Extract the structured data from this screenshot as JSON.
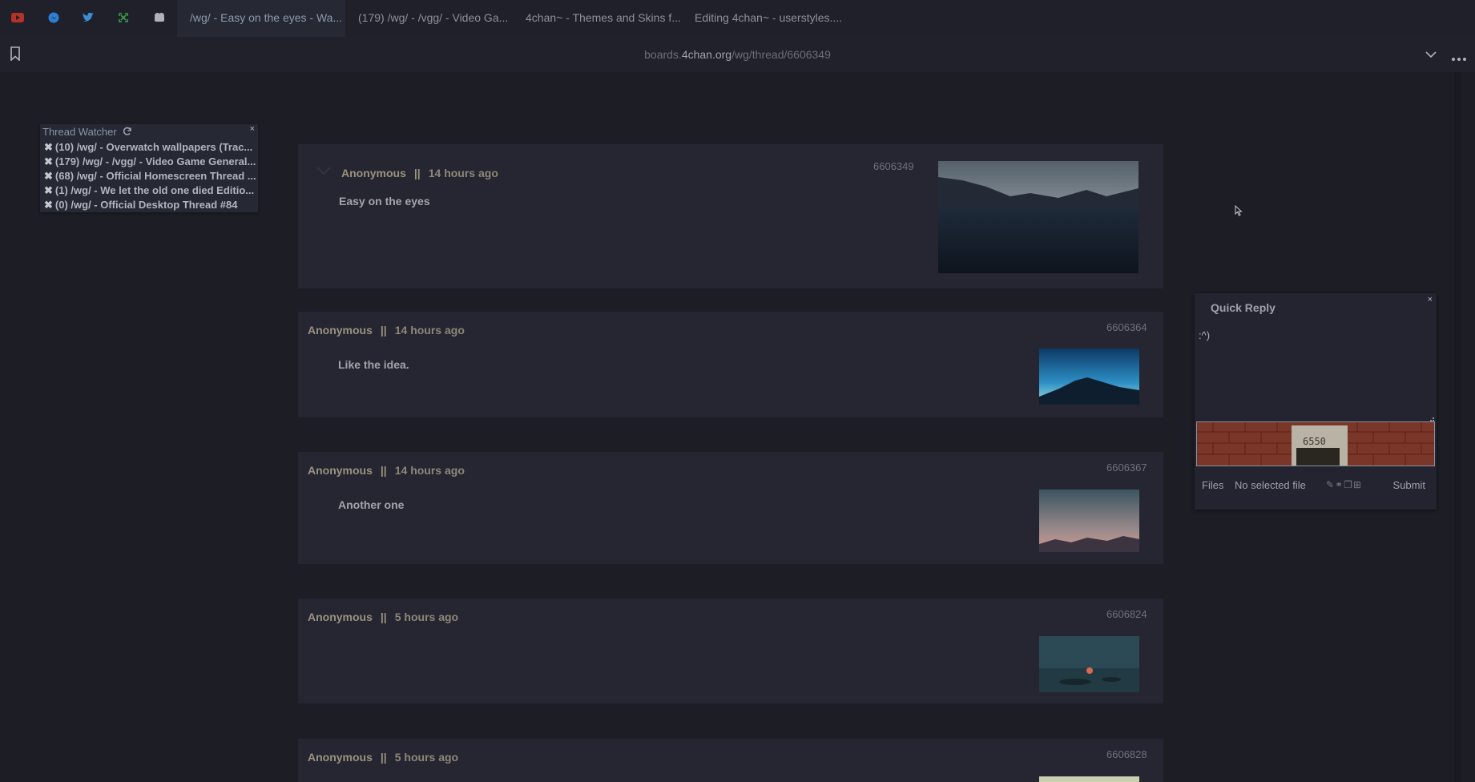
{
  "browser": {
    "pinned": [
      {
        "icon": "youtube-icon",
        "color": "#c0392b"
      },
      {
        "icon": "messenger-icon",
        "color": "#2e86de"
      },
      {
        "icon": "twitter-icon",
        "color": "#3b8fd0"
      },
      {
        "icon": "expand-icon",
        "color": "#3aa04a"
      },
      {
        "icon": "4chan-clover-icon",
        "color": "#b0b2ba"
      }
    ],
    "tabs": [
      {
        "label": "/wg/ - Easy on the eyes - Wa...",
        "active": true
      },
      {
        "label": "(179) /wg/ - /vgg/ - Video Ga..."
      },
      {
        "label": "4chan~ - Themes and Skins f..."
      },
      {
        "label": "Editing 4chan~ - userstyles...."
      }
    ],
    "url_prefix": "boards.",
    "url_host": "4chan.org",
    "url_path": "/wg/thread/6606349"
  },
  "thread_watcher": {
    "title": "Thread Watcher",
    "close": "×",
    "items": [
      "(10) /wg/ - Overwatch wallpapers (Trac...",
      "(179) /wg/ - /vgg/ - Video Game General...",
      "(68) /wg/ - Official Homescreen Thread ...",
      "(1) /wg/ - We let the old one died Editio...",
      "(0) /wg/ - Official Desktop Thread #84"
    ]
  },
  "posts": [
    {
      "name": "Anonymous",
      "sep": "||",
      "time": "14 hours ago",
      "number": "6606349",
      "message": "Easy on the eyes"
    },
    {
      "name": "Anonymous",
      "sep": "||",
      "time": "14 hours ago",
      "number": "6606364",
      "message": "Like the idea."
    },
    {
      "name": "Anonymous",
      "sep": "||",
      "time": "14 hours ago",
      "number": "6606367",
      "message": "Another one"
    },
    {
      "name": "Anonymous",
      "sep": "||",
      "time": "5 hours ago",
      "number": "6606824",
      "message": ""
    },
    {
      "name": "Anonymous",
      "sep": "||",
      "time": "5 hours ago",
      "number": "6606828",
      "message": ""
    }
  ],
  "quick_reply": {
    "title": "Quick Reply",
    "close": "×",
    "comment": ":^)",
    "captcha_text": "6550",
    "files_label": "Files",
    "no_file": "No selected file",
    "submit": "Submit"
  }
}
